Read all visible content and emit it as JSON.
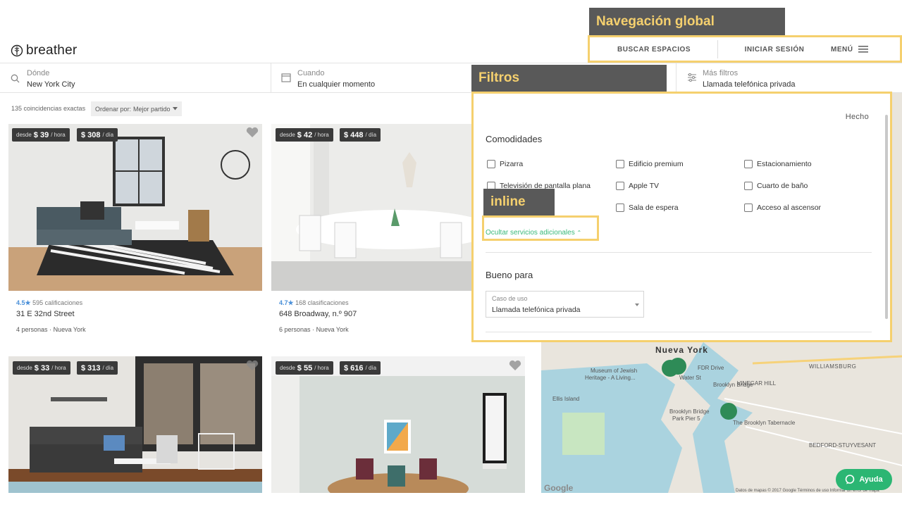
{
  "brand": {
    "name": "breather"
  },
  "topnav": {
    "search_spaces": "BUSCAR ESPACIOS",
    "login": "INICIAR SESIÓN",
    "menu": "MENÚ"
  },
  "searchbar": {
    "where": {
      "label": "Dónde",
      "value": "New York City"
    },
    "when": {
      "label": "Cuando",
      "value": "En cualquier momento"
    },
    "filters": {
      "label": "Más filtros",
      "value": "Llamada telefónica privada"
    }
  },
  "results": {
    "count": "135 coincidencias exactas",
    "sort_label": "Ordenar por:",
    "sort_value": "Mejor partido"
  },
  "cards": [
    {
      "from": "desde",
      "hourly": "$ 39",
      "per_hour": "/ hora",
      "daily": "$ 308",
      "per_day": "/ día",
      "rating": "4.5",
      "star": "★",
      "reviews": "595 calificaciones",
      "address": "31 E 32nd Street",
      "people": "4 personas",
      "dot": "·",
      "city": "Nueva York"
    },
    {
      "from": "desde",
      "hourly": "$ 42",
      "per_hour": "/ hora",
      "daily": "$ 448",
      "per_day": "/ día",
      "rating": "4.7",
      "star": "★",
      "reviews": "168 clasificaciones",
      "address": "648 Broadway, n.º 907",
      "people": "6 personas",
      "dot": "·",
      "city": "Nueva York"
    },
    {
      "from": "desde",
      "hourly": "$ 33",
      "per_hour": "/ hora",
      "daily": "$ 313",
      "per_day": "/ día"
    },
    {
      "from": "desde",
      "hourly": "$ 55",
      "per_hour": "/ hora",
      "daily": "$ 616",
      "per_day": "/ día"
    }
  ],
  "filters_panel": {
    "done": "Hecho",
    "amenities_title": "Comodidades",
    "amenities": [
      "Pizarra",
      "Edificio premium",
      "Estacionamiento",
      "Televisión de pantalla plana",
      "Apple TV",
      "Cuarto de baño",
      "Sala de espera",
      "Acceso al ascensor"
    ],
    "hide_link": "Ocultar servicios adicionales",
    "hide_chevron": "⌃",
    "good_for_title": "Bueno para",
    "use_case_label": "Caso de uso",
    "use_case_value": "Llamada telefónica privada"
  },
  "annotations": {
    "global_nav": "Navegación global",
    "filters": "Filtros",
    "inline": "inline"
  },
  "map": {
    "labels": [
      "Nueva York",
      "Museum of Jewish",
      "Heritage - A Living...",
      "Ellis Island",
      "Brooklyn Bridge",
      "Park Pier 5",
      "The Brooklyn Tabernacle",
      "WILLIAMSBURG",
      "VINEGAR HILL",
      "BEDFORD-STUYVESANT",
      "FDR Drive",
      "Water St",
      "Brooklyn Bridge"
    ],
    "google": "Google",
    "attribution": "Datos de mapas © 2017 Google  Términos de uso  Informar un error de mapa"
  },
  "help": {
    "label": "Ayuda"
  },
  "colors": {
    "accent_green": "#2bb673",
    "annotation_yellow": "#f5d06e",
    "annotation_bg": "#595959",
    "price_bg": "#3a3a3a",
    "rating_blue": "#4a90d9"
  }
}
